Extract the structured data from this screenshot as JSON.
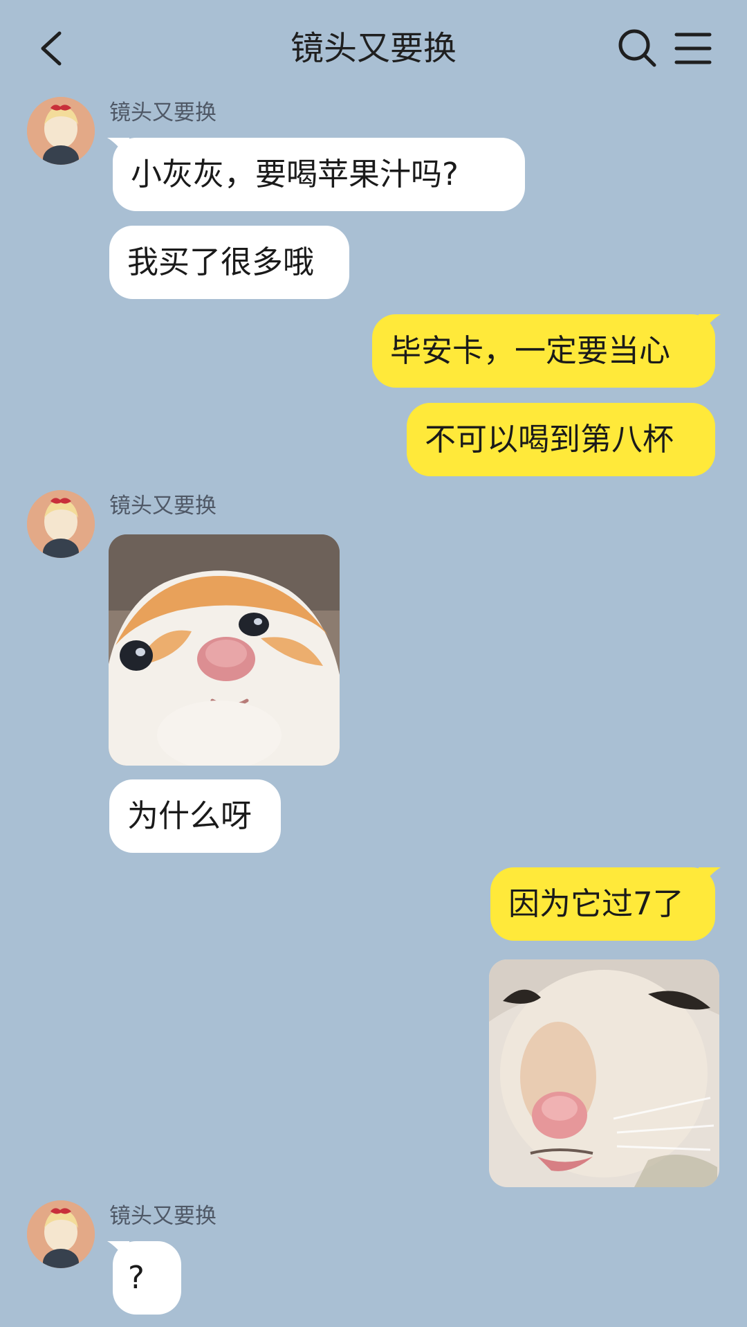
{
  "header": {
    "title": "镜头又要换",
    "back_icon": "chevron-left-icon",
    "search_icon": "search-icon",
    "menu_icon": "menu-icon"
  },
  "contact": {
    "name": "镜头又要换"
  },
  "messages": [
    {
      "from": "contact",
      "type": "text",
      "text": "小灰灰，要喝苹果汁吗?"
    },
    {
      "from": "contact",
      "type": "text",
      "text": "我买了很多哦"
    },
    {
      "from": "me",
      "type": "text",
      "text": "毕安卡，一定要当心"
    },
    {
      "from": "me",
      "type": "text",
      "text": "不可以喝到第八杯"
    },
    {
      "from": "contact",
      "type": "sticker",
      "sticker": "kitten-looking-up-sticker"
    },
    {
      "from": "contact",
      "type": "text",
      "text": "为什么呀"
    },
    {
      "from": "me",
      "type": "text",
      "text": "因为它过7了"
    },
    {
      "from": "me",
      "type": "sticker",
      "sticker": "squinting-cat-sticker"
    },
    {
      "from": "contact",
      "type": "text",
      "text": "?"
    }
  ],
  "colors": {
    "background": "#a9bfd3",
    "incoming_bubble": "#ffffff",
    "outgoing_bubble": "#ffe93a",
    "avatar_bg": "#e3a987"
  }
}
